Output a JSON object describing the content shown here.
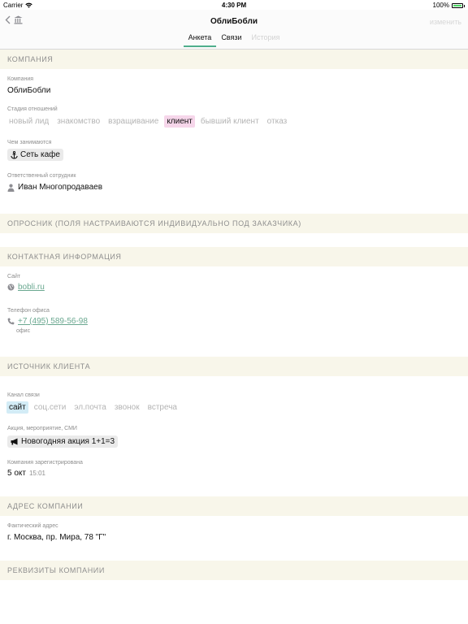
{
  "status_bar": {
    "carrier": "Carrier",
    "time": "4:30 PM",
    "battery": "100%",
    "battery_level": 1.0
  },
  "nav": {
    "title": "ОблиБобли",
    "edit_label": "изменить",
    "tabs": [
      {
        "label": "Анкета"
      },
      {
        "label": "Связи"
      },
      {
        "label": "История"
      }
    ]
  },
  "sections": {
    "company": "КОМПАНИЯ",
    "survey": "ОПРОСНИК (ПОЛЯ НАСТРАИВАЮТСЯ ИНДИВИДУАЛЬНО ПОД ЗАКАЗЧИКА)",
    "contacts": "КОНТАКТНАЯ ИНФОРМАЦИЯ",
    "source": "ИСТОЧНИК КЛИЕНТА",
    "address": "АДРЕС КОМПАНИИ",
    "requisites": "РЕКВИЗИТЫ КОМПАНИИ"
  },
  "company": {
    "name_label": "Компания",
    "name": "ОблиБобли",
    "stage_label": "Стадия отношений",
    "stages": [
      "новый лид",
      "знакомство",
      "взращивание",
      "клиент",
      "бывший клиент",
      "отказ"
    ],
    "stage_selected": "клиент",
    "activity_label": "Чем занимаются",
    "activity": "Сеть кафе",
    "responsible_label": "Ответственный сотрудник",
    "responsible": "Иван Многопродаваев"
  },
  "contacts": {
    "site_label": "Сайт",
    "site": "bobli.ru",
    "phone_label": "Телефон офиса",
    "phone": "+7 (495) 589-56-98",
    "phone_note": "офис"
  },
  "source": {
    "channel_label": "Канал связи",
    "channels": [
      "сайт",
      "соц.сети",
      "эл.почта",
      "звонок",
      "встреча"
    ],
    "channel_selected": "сайт",
    "promo_label": "Акция, мероприятие, СМИ",
    "promo": "Новогодняя акция 1+1=3",
    "registered_label": "Компания зарегистрирована",
    "registered_date": "5 окт",
    "registered_time": "15:01"
  },
  "address": {
    "label": "Фактический адрес",
    "value": "г. Москва, пр. Мира, 78 \"Г\""
  },
  "colors": {
    "accent": "#4fae8c",
    "section_bg": "#f8f6ea",
    "chip_pink": "#f6d6ea",
    "chip_blue": "#d3ecf6"
  }
}
